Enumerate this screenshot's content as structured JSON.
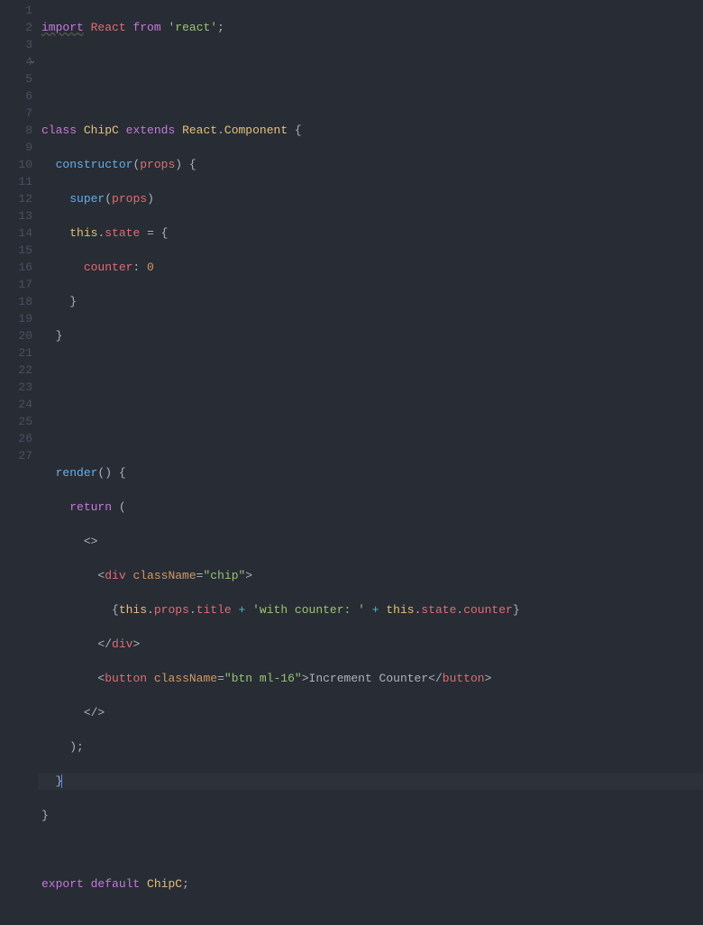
{
  "line_numbers": [
    "1",
    "2",
    "3",
    "4",
    "5",
    "6",
    "7",
    "8",
    "9",
    "10",
    "11",
    "12",
    "13",
    "14",
    "15",
    "16",
    "17",
    "18",
    "19",
    "20",
    "21",
    "22",
    "23",
    "24",
    "25",
    "26",
    "27"
  ],
  "fold_line": "4",
  "highlight_line": "23",
  "code": {
    "l1": {
      "import": "import",
      "react": "React",
      "from": "from",
      "pkg": "'react'",
      "semi": ";"
    },
    "l4": {
      "class": "class",
      "name": "ChipC",
      "extends": "extends",
      "super": "React",
      "dot": ".",
      "comp": "Component",
      "brace": " {"
    },
    "l5": {
      "ctor": "constructor",
      "lp": "(",
      "props": "props",
      "rp": ") {"
    },
    "l6": {
      "super": "super",
      "lp": "(",
      "props": "props",
      "rp": ")"
    },
    "l7": {
      "this": "this",
      "dot": ".",
      "state": "state",
      "eq": " = ",
      "brace": "{"
    },
    "l8": {
      "key": "counter",
      "colon": ": ",
      "val": "0"
    },
    "l9": {
      "brace": "}"
    },
    "l10": {
      "brace": "}"
    },
    "l14": {
      "render": "render",
      "parens": "() ",
      "brace": "{"
    },
    "l15": {
      "return": "return",
      "paren": " ("
    },
    "l16": {
      "frag": "<>"
    },
    "l17": {
      "open": "<",
      "tag": "div",
      "attr": "className",
      "eq": "=",
      "val": "\"chip\"",
      "close": ">"
    },
    "l18": {
      "lb": "{",
      "this1": "this",
      "d1": ".",
      "props": "props",
      "d2": ".",
      "title": "title",
      "plus1": " + ",
      "str": "'with counter: '",
      "plus2": " + ",
      "this2": "this",
      "d3": ".",
      "state": "state",
      "d4": ".",
      "counter": "counter",
      "rb": "}"
    },
    "l19": {
      "open": "</",
      "tag": "div",
      "close": ">"
    },
    "l20": {
      "open": "<",
      "tag": "button",
      "attr": "className",
      "eq": "=",
      "val": "\"btn ml-16\"",
      "close": ">",
      "text": "Increment Counter",
      "copen": "</",
      "ctag": "button",
      "cclose": ">"
    },
    "l21": {
      "frag": "</>"
    },
    "l22": {
      "paren": ");"
    },
    "l23": {
      "brace": "}"
    },
    "l24": {
      "brace": "}"
    },
    "l26": {
      "export": "export",
      "default": "default",
      "name": "ChipC",
      "semi": ";"
    }
  }
}
